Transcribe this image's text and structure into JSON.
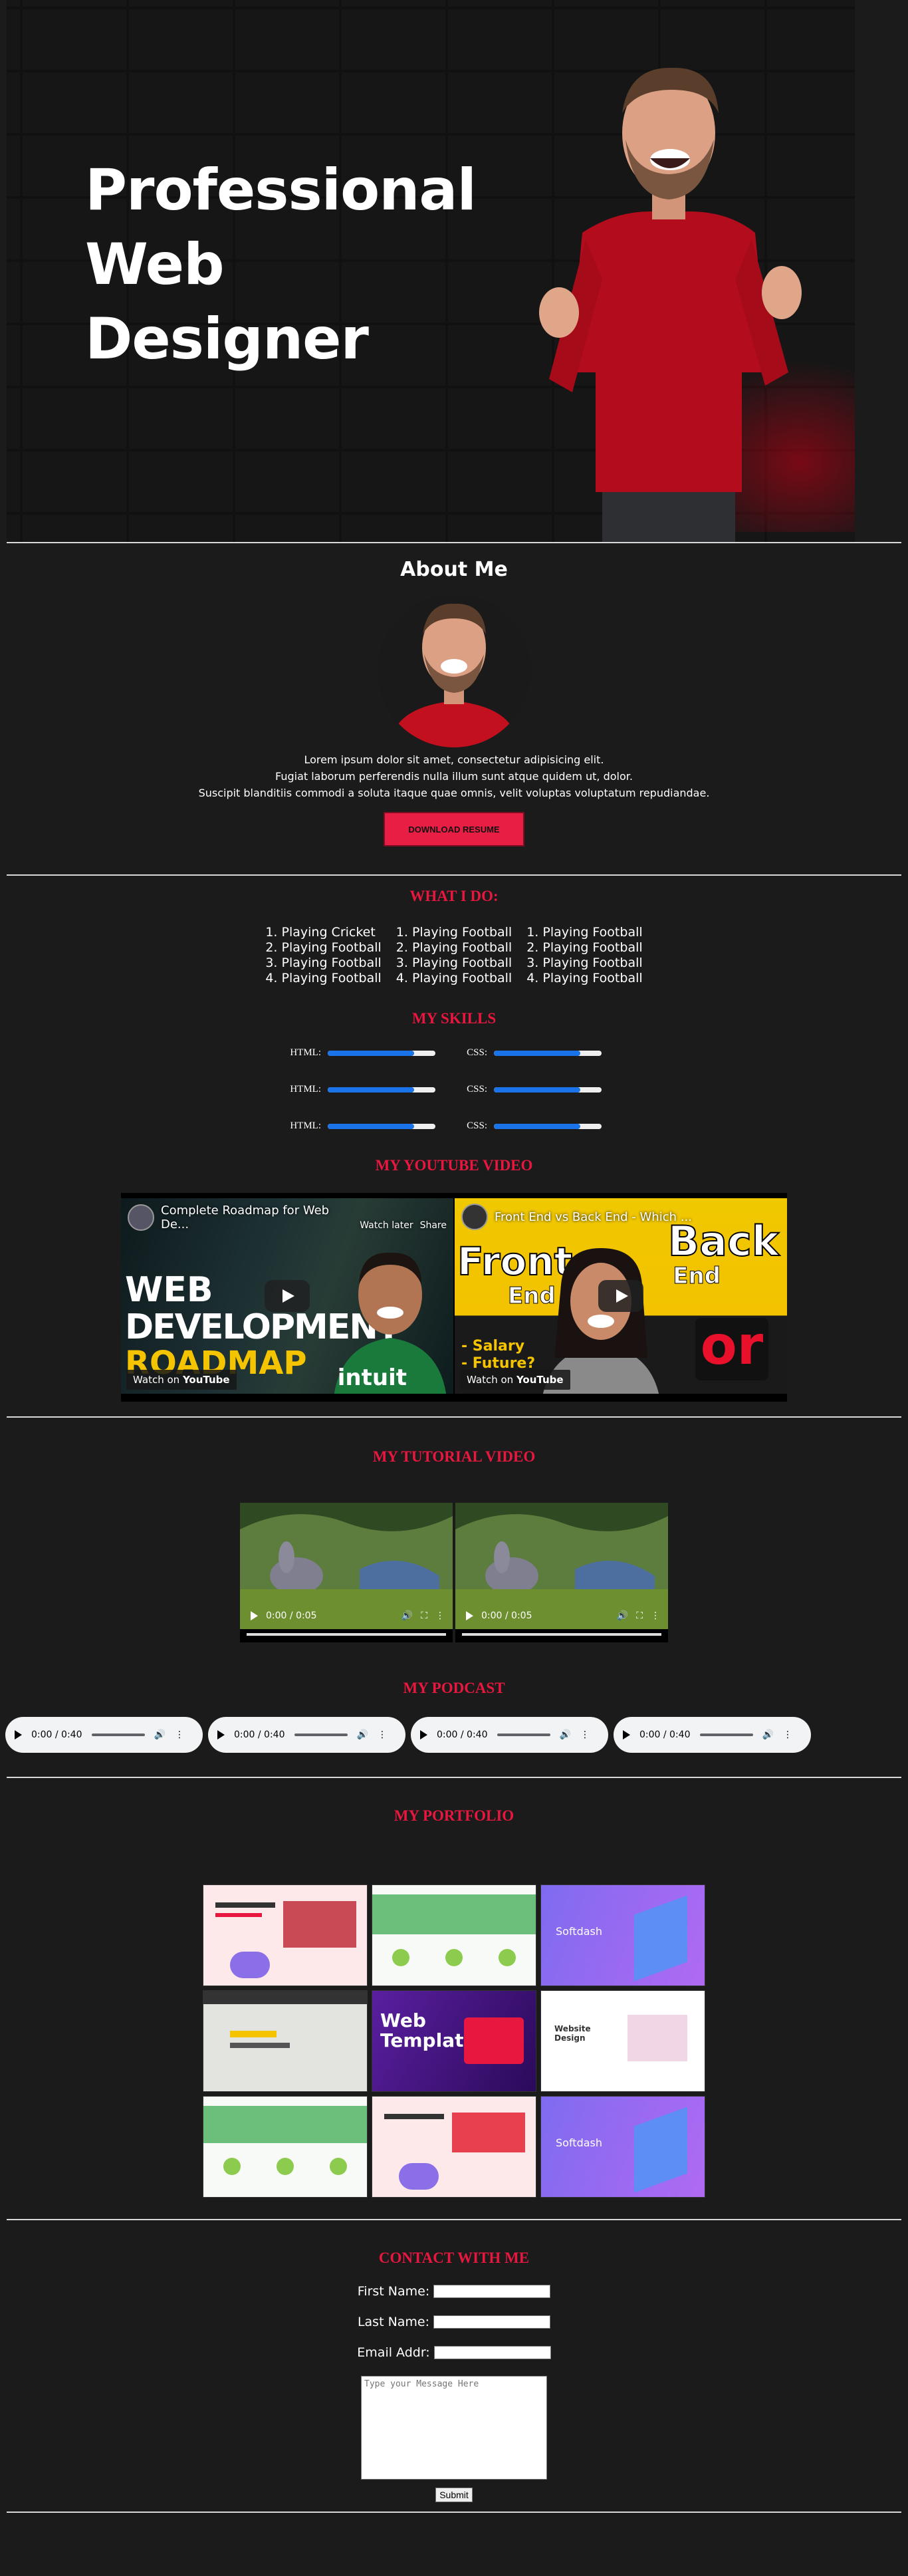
{
  "hero": {
    "title_line1": "Professional",
    "title_line2": "Web",
    "title_line3": "Designer"
  },
  "about": {
    "title": "About Me",
    "line1": "Lorem ipsum dolor sit amet, consectetur adipisicing elit.",
    "line2": "Fugiat laborum perferendis nulla illum sunt atque quidem ut, dolor.",
    "line3": "Suscipit blanditiis commodi a soluta itaque quae omnis, velit voluptas voluptatum repudiandae.",
    "button": "DOWNLOAD RESUME"
  },
  "what_i_do": {
    "title": "WHAT I DO:",
    "lists": [
      [
        "1. Playing Cricket",
        "2. Playing Football",
        "3. Playing Football",
        "4. Playing Football"
      ],
      [
        "1. Playing Football",
        "2. Playing Football",
        "3. Playing Football",
        "4. Playing Football"
      ],
      [
        "1. Playing Football",
        "2. Playing Football",
        "3. Playing Football",
        "4. Playing Football"
      ]
    ]
  },
  "skills": {
    "title": "MY SKILLS",
    "rows": [
      {
        "a_label": "HTML:",
        "a_value": 0.8,
        "b_label": "CSS:",
        "b_value": 0.8
      },
      {
        "a_label": "HTML:",
        "a_value": 0.8,
        "b_label": "CSS:",
        "b_value": 0.8
      },
      {
        "a_label": "HTML:",
        "a_value": 0.8,
        "b_label": "CSS:",
        "b_value": 0.8
      }
    ]
  },
  "youtube": {
    "title": "MY YOUTUBE VIDEO",
    "video1": {
      "title": "Complete Roadmap for Web De...",
      "watch_later": "Watch later",
      "share": "Share",
      "watch_on": "Watch on",
      "brand": "YouTube",
      "overlay1": "WEB",
      "overlay2": "DEVELOPMENT",
      "overlay3": "ROADMAP",
      "shirt": "intuit"
    },
    "video2": {
      "title": "Front End vs Back End - Which ...",
      "watch_on": "Watch on",
      "brand": "YouTube",
      "front": "Front",
      "end1": "End",
      "back": "Back",
      "end2": "End",
      "or": "or",
      "salary": "- Salary",
      "future": "- Future?"
    }
  },
  "tutorial": {
    "title": "MY TUTORIAL VIDEO",
    "videos": [
      {
        "time": "0:00 / 0:05"
      },
      {
        "time": "0:00 / 0:05"
      }
    ]
  },
  "podcast": {
    "title": "MY PODCAST",
    "tracks": [
      {
        "time": "0:00 / 0:40"
      },
      {
        "time": "0:00 / 0:40"
      },
      {
        "time": "0:00 / 0:40"
      },
      {
        "time": "0:00 / 0:40"
      }
    ]
  },
  "portfolio": {
    "title": "MY PORTFOLIO",
    "items": [
      "Softdash",
      "Website Design",
      "Web Template",
      "Softdash"
    ]
  },
  "contact": {
    "title": "CONTACT WITH ME",
    "first_name": "First Name:",
    "last_name": "Last Name:",
    "email": "Email Addr:",
    "message_placeholder": "Type your Message Here",
    "submit": "Submit"
  },
  "colors": {
    "accent": "#e8173f",
    "background": "#1b1b1b",
    "progress": "#1a73e8"
  }
}
